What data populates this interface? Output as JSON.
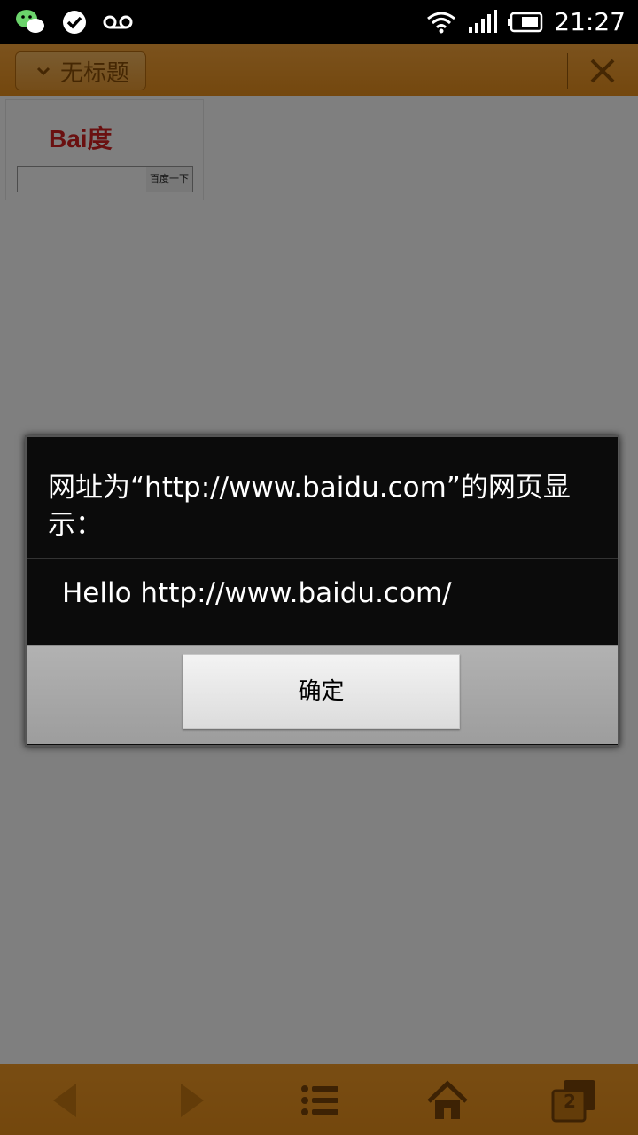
{
  "status_bar": {
    "time": "21:27"
  },
  "titlebar": {
    "tab_title": "无标题"
  },
  "page": {
    "baidu_logo_text": "Bai度",
    "baidu_button": "百度一下"
  },
  "dialog": {
    "title": "网址为“http://www.baidu.com”的网页显示：",
    "message": "Hello http://www.baidu.com/",
    "ok_label": "确定"
  },
  "toolbar": {
    "tab_count": "2"
  },
  "colors": {
    "accent": "#f29a26"
  }
}
